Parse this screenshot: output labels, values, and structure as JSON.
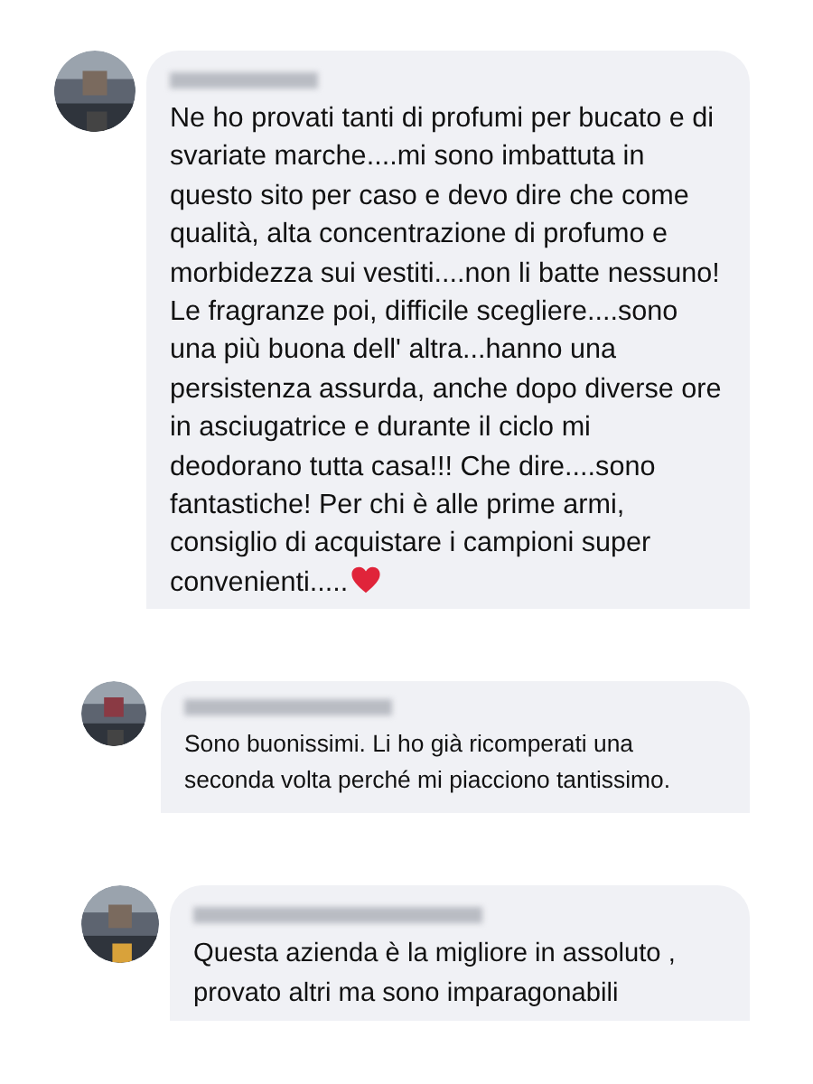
{
  "comments": [
    {
      "text": "Ne ho provati tanti di profumi per bucato e di svariate marche....mi sono imbattuta in questo sito per caso e devo dire che come qualità, alta concentrazione di profumo e morbidezza sui vestiti....non li batte nessuno! Le fragranze poi, difficile scegliere....sono una più buona dell' altra...hanno una persistenza assurda, anche dopo diverse ore in asciugatrice e durante il ciclo mi deodorano tutta casa!!! Che dire....sono fantastiche! Per chi è alle prime armi, consiglio di acquistare i campioni super convenienti.....",
      "heart": true
    },
    {
      "text": "Sono buonissimi. Li ho già ricomperati una seconda volta perché mi piacciono tantissimo.",
      "heart": false
    },
    {
      "text": "Questa azienda è la migliore in assoluto , provato altri ma sono imparagonabili",
      "heart": false
    }
  ]
}
